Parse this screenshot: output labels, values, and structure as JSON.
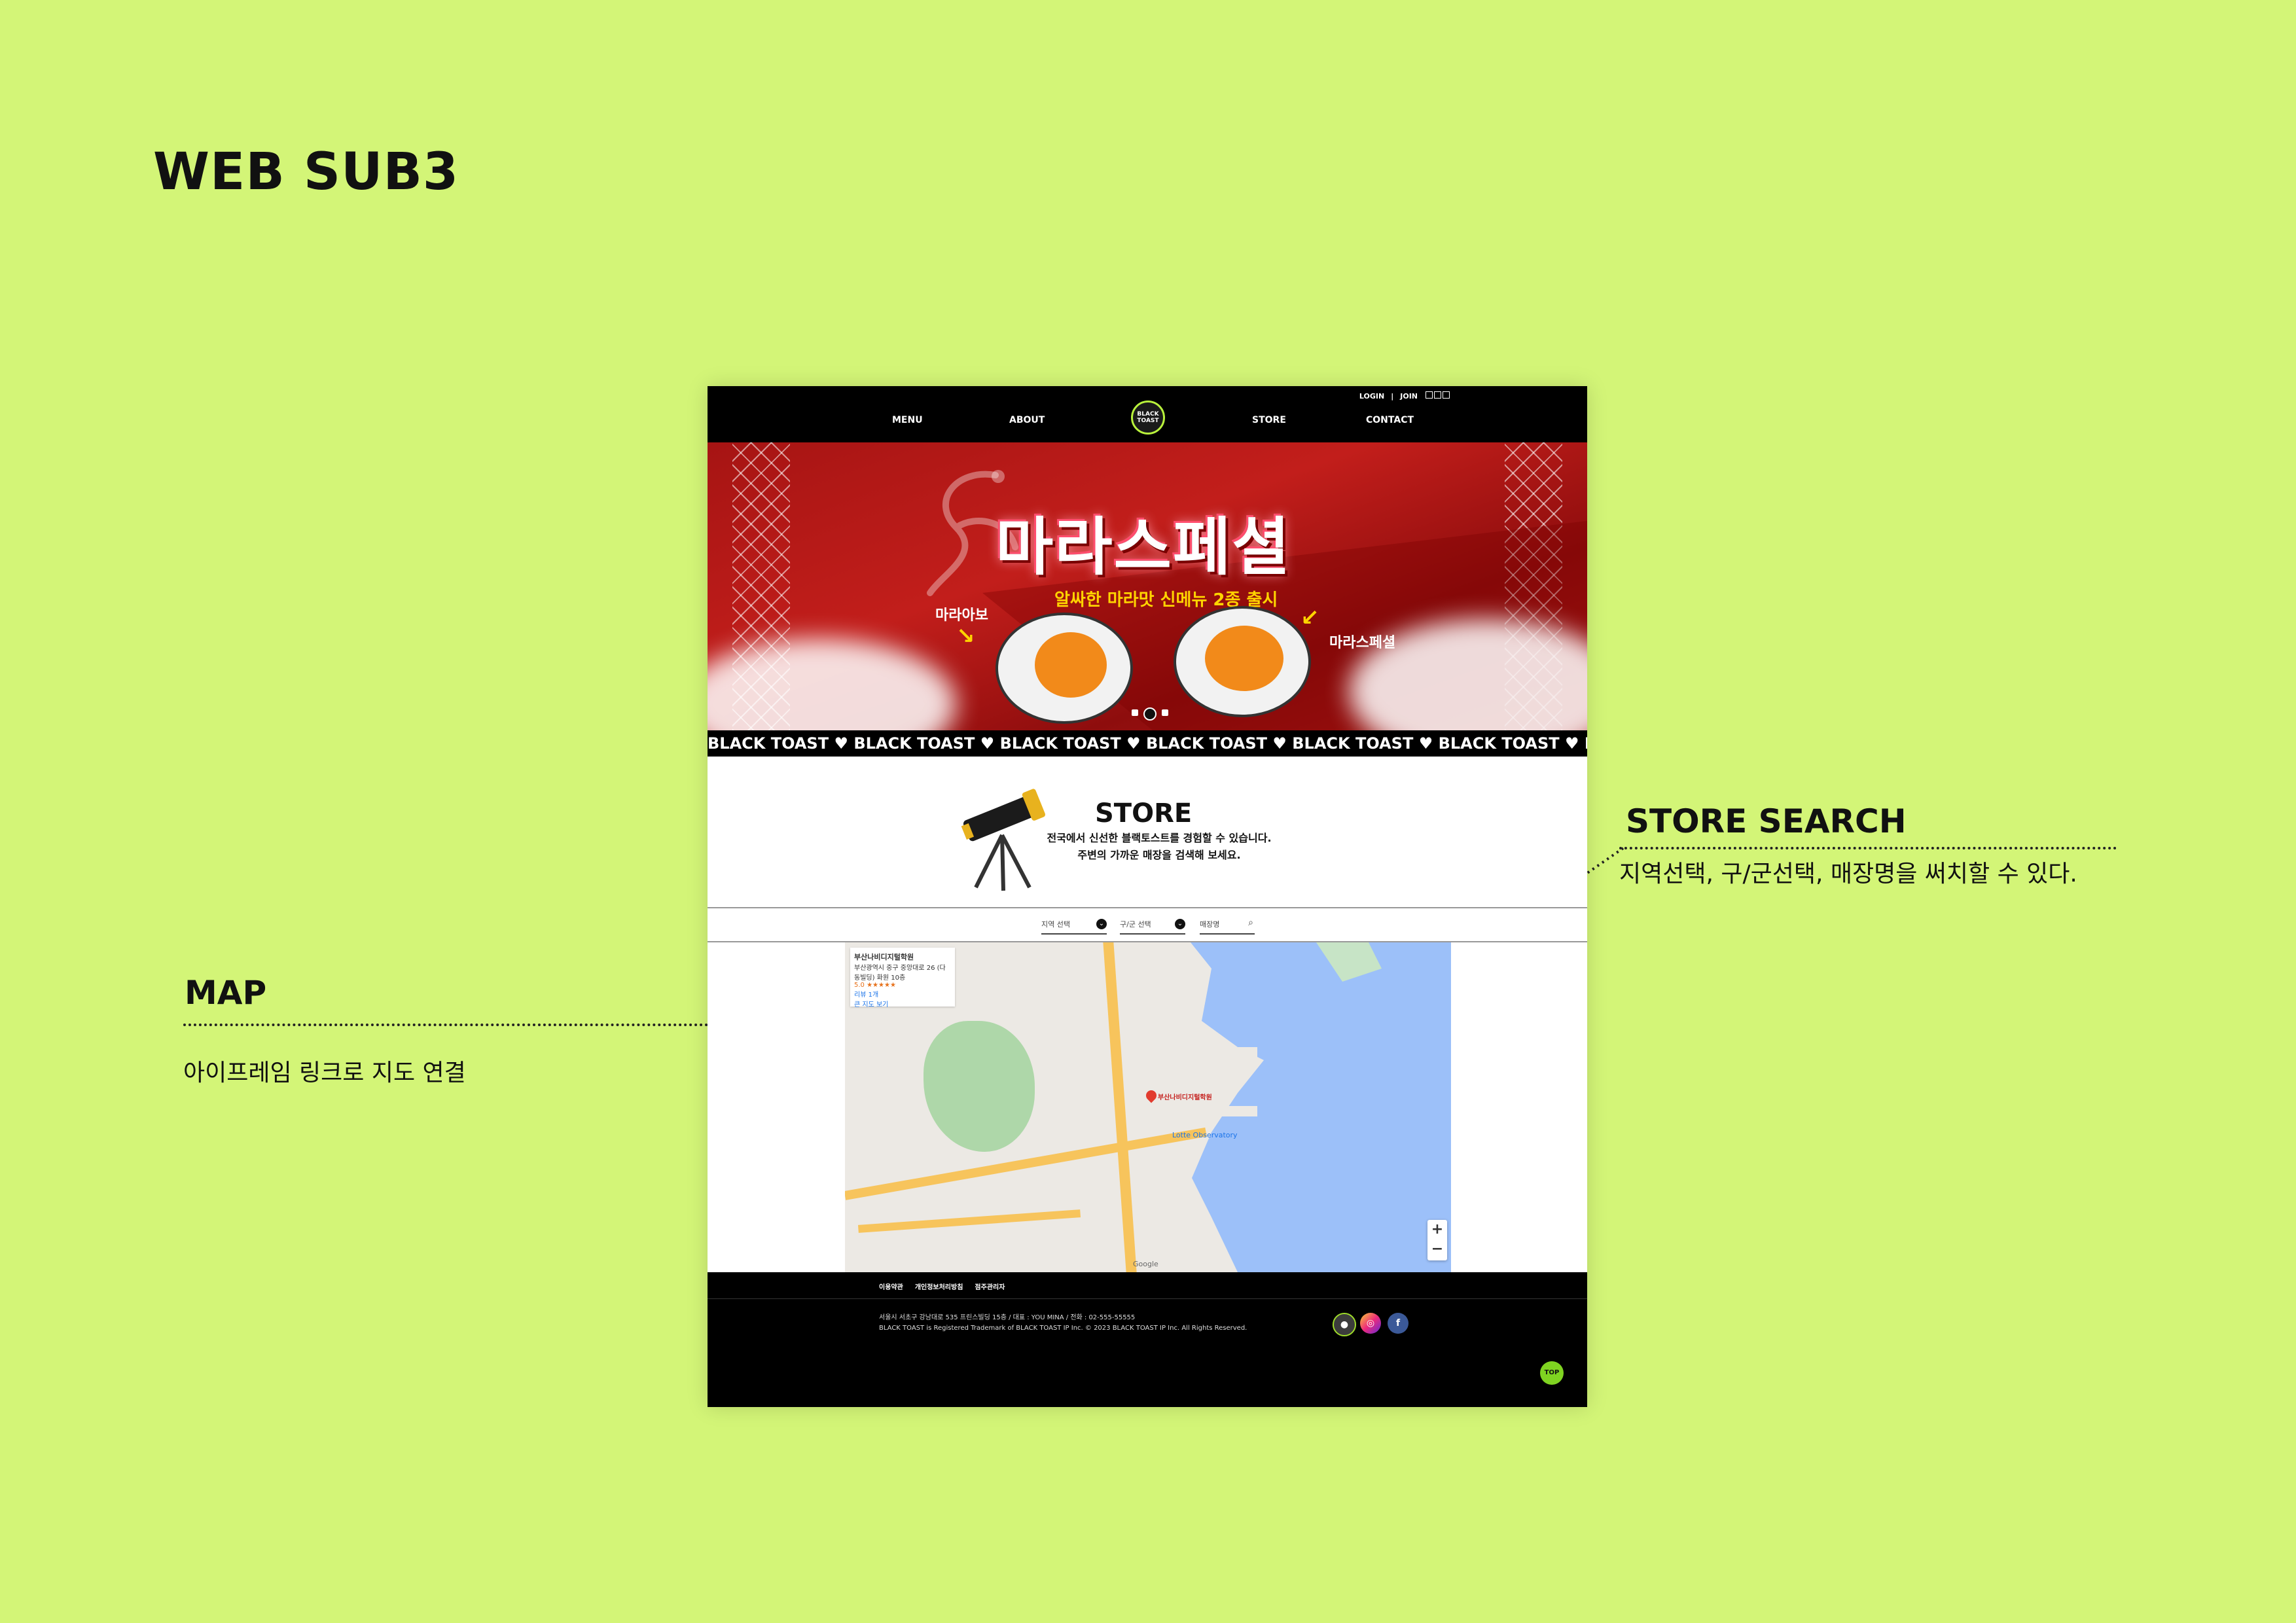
{
  "page_title": "WEB SUB3",
  "annotations": {
    "store_search": {
      "title": "STORE SEARCH",
      "desc": "지역선택, 구/군선택, 매장명을 써치할 수 있다."
    },
    "map": {
      "title": "MAP",
      "desc": "아이프레임 링크로 지도 연결"
    }
  },
  "site": {
    "util": {
      "login": "LOGIN",
      "sep": "|",
      "join": "JOIN"
    },
    "nav": {
      "menu": "MENU",
      "about": "ABOUT",
      "store": "STORE",
      "contact": "CONTACT"
    },
    "logo_text": "BLACK TOAST",
    "banner": {
      "title": "마라스페셜",
      "subtitle": "알싸한 마라맛 신메뉴 2종 출시",
      "label_left": "마라아보",
      "label_right": "마라스페셜",
      "slide_count": 3,
      "active_slide": 2
    },
    "ticker": "BLACK TOAST ♥ BLACK TOAST ♥ BLACK TOAST ♥ BLACK TOAST ♥ BLACK TOAST ♥ BLACK TOAST ♥ BLACK",
    "store": {
      "title": "STORE",
      "desc_line1": "전국에서 신선한 블랙토스트를 경험할 수 있습니다.",
      "desc_line2": "주변의 가까운 매장을 검색해 보세요."
    },
    "search": {
      "region_label": "지역 선택",
      "district_label": "구/군 선택",
      "store_name_placeholder": "매장명"
    },
    "map": {
      "place_name": "부산나비디지털학원",
      "place_address": "부산광역시 중구 중앙대로 26 (다동빌딩) 화원 10층",
      "rating": "5.0 ★★★★★",
      "reviews": "리뷰 1개",
      "bigger_map": "큰 지도 보기",
      "landmark": "Lotte Observatory",
      "zoom_in": "+",
      "zoom_out": "−",
      "google": "Google"
    },
    "footer": {
      "links": [
        "이용약관",
        "개인정보처리방침",
        "점주관리자"
      ],
      "address": "서울시 서초구 강남대로 535 프린스빌딩 15층 / 대표 : YOU MINA / 전화 : 02-555-55555",
      "copyright": "BLACK TOAST is Registered Trademark of BLACK TOAST IP Inc. © 2023 BLACK TOAST IP Inc. All Rights Reserved.",
      "top": "TOP"
    },
    "colors": {
      "accent": "#d3f577",
      "banner_red": "#b11a17",
      "yellow": "#ffd400",
      "black": "#000000"
    }
  }
}
